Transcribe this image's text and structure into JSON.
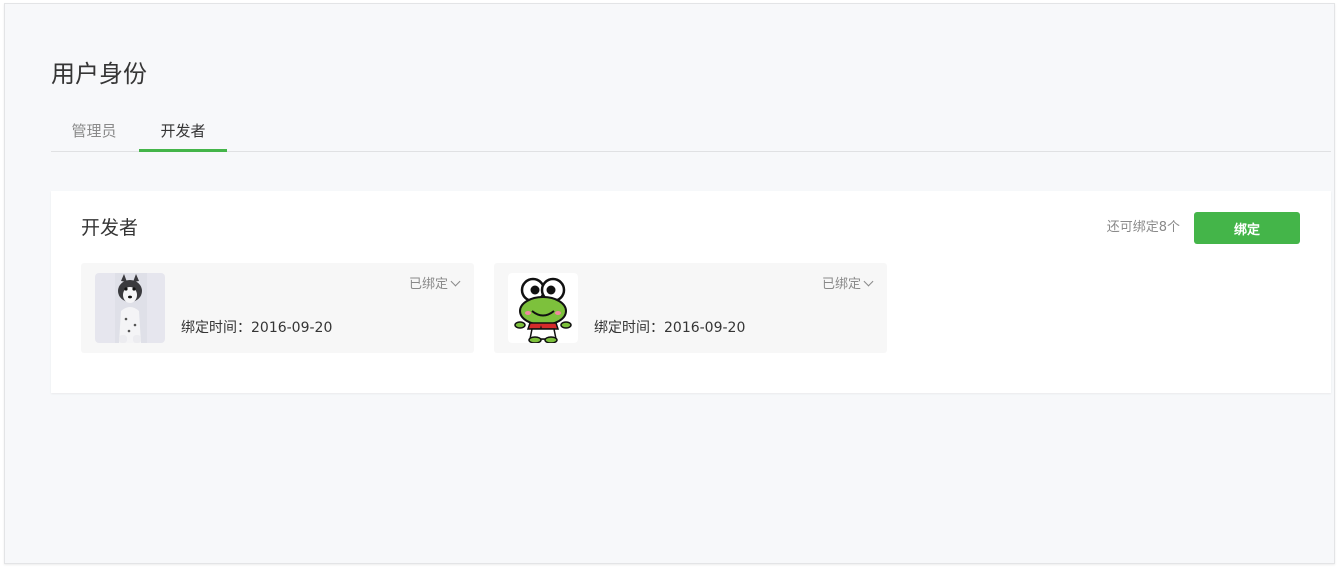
{
  "page": {
    "title": "用户身份"
  },
  "tabs": [
    {
      "label": "管理员",
      "active": false
    },
    {
      "label": "开发者",
      "active": true
    }
  ],
  "developers_card": {
    "title": "开发者",
    "remaining_text": "还可绑定8个",
    "bind_button_label": "绑定",
    "items": [
      {
        "avatar": "husky-dog-photo",
        "status": "已绑定",
        "bind_time_label": "绑定时间：",
        "bind_time": "2016-09-20"
      },
      {
        "avatar": "green-frog-cartoon",
        "status": "已绑定",
        "bind_time_label": "绑定时间：",
        "bind_time": "2016-09-20"
      }
    ]
  },
  "colors": {
    "accent": "#44b549",
    "background": "#f7f8fa",
    "card": "#ffffff",
    "item_background": "#f7f7f7",
    "text_primary": "#353535",
    "text_secondary": "#8a8a8a"
  },
  "icons": [
    "chevron-down-icon"
  ]
}
